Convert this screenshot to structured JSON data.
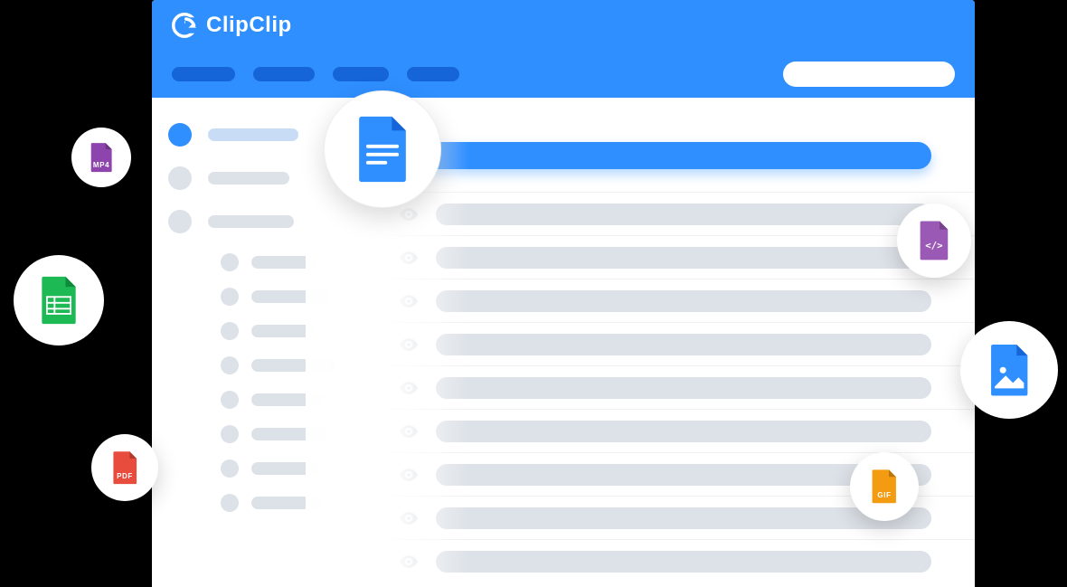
{
  "brand": {
    "name": "ClipClip"
  },
  "badges": {
    "mp4": {
      "label": "MP4",
      "color": "#8E44AD"
    },
    "sheet": {
      "label": "",
      "color": "#1DB954"
    },
    "pdf": {
      "label": "PDF",
      "color": "#E74C3C"
    },
    "code": {
      "label": "</>",
      "color": "#9B59B6"
    },
    "image": {
      "label": "",
      "color": "#2F8FFF"
    },
    "gif": {
      "label": "GIF",
      "color": "#F39C12"
    }
  }
}
